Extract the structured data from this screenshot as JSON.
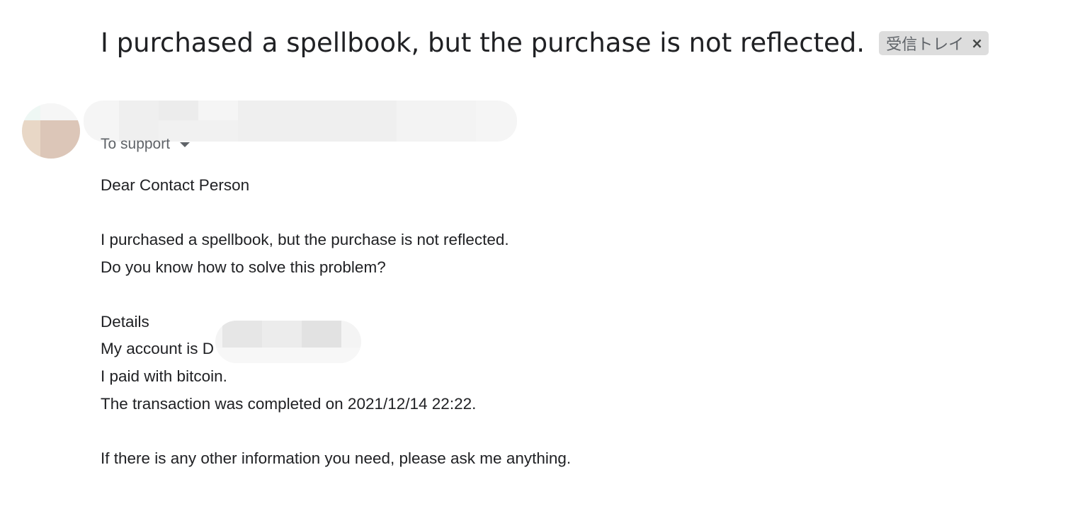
{
  "email": {
    "subject": "I purchased a spellbook, but the purchase is not reflected.",
    "label": "受信トレイ",
    "label_close": "×",
    "recipient": "To support",
    "body": {
      "greeting": "Dear Contact Person",
      "line1": "I purchased a spellbook, but the purchase is not reflected.",
      "line2": "Do you know how to solve this problem?",
      "details_heading": "Details",
      "account_prefix": "My account is D",
      "payment": "I paid with bitcoin.",
      "transaction": "The transaction was completed on 2021/12/14 22:22.",
      "closing": "If there is any other information you need, please ask me anything."
    }
  },
  "icons": {
    "label_remove": "close-icon",
    "recipient_details": "caret-down-icon"
  }
}
